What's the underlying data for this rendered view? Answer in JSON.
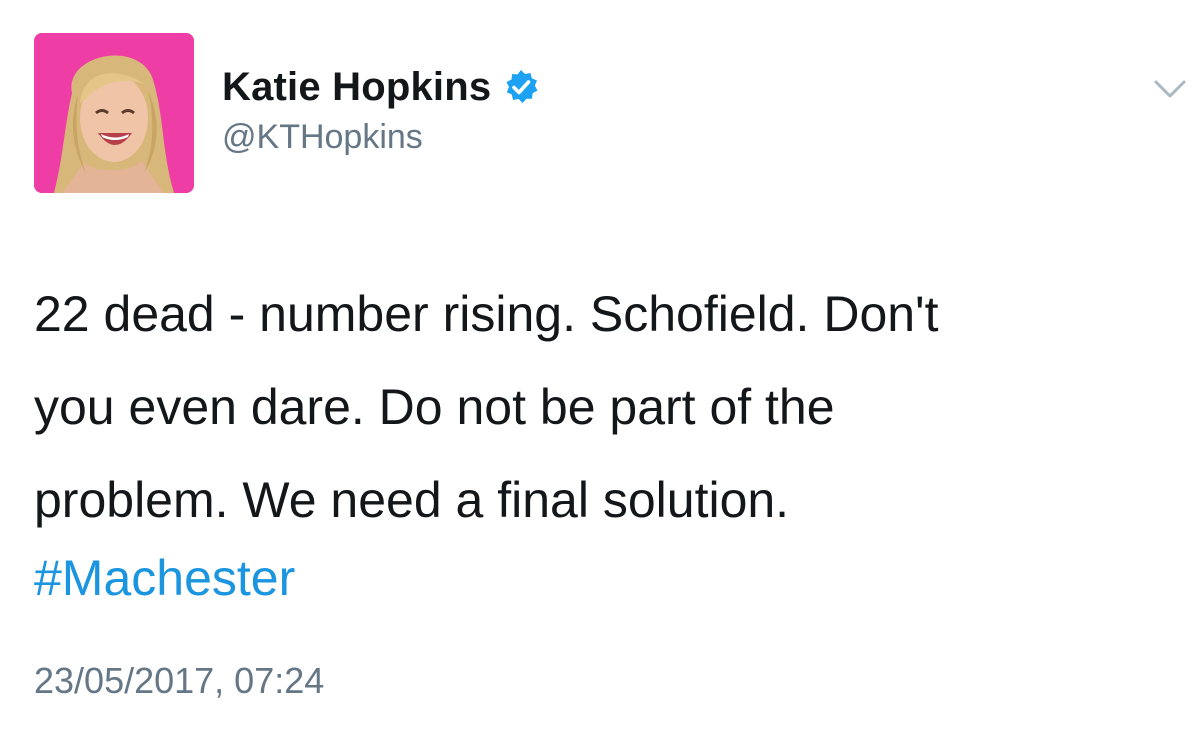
{
  "author": {
    "display_name": "Katie Hopkins",
    "handle": "@KTHopkins",
    "verified": true,
    "avatar": "profile-photo"
  },
  "tweet": {
    "lines": [
      "22 dead - number rising. Schofield. Don't",
      "you even dare. Do not be part of the",
      "problem. We need a final solution."
    ],
    "hashtag": "#Machester",
    "timestamp": "23/05/2017, 07:24"
  },
  "icons": {
    "verified": "verified-badge-icon",
    "menu": "chevron-down-icon"
  },
  "colors": {
    "text": "#14171a",
    "secondary": "#657786",
    "link": "#1b95e0",
    "verified": "#1da1f2",
    "avatar_background": "#ee3ea5"
  }
}
